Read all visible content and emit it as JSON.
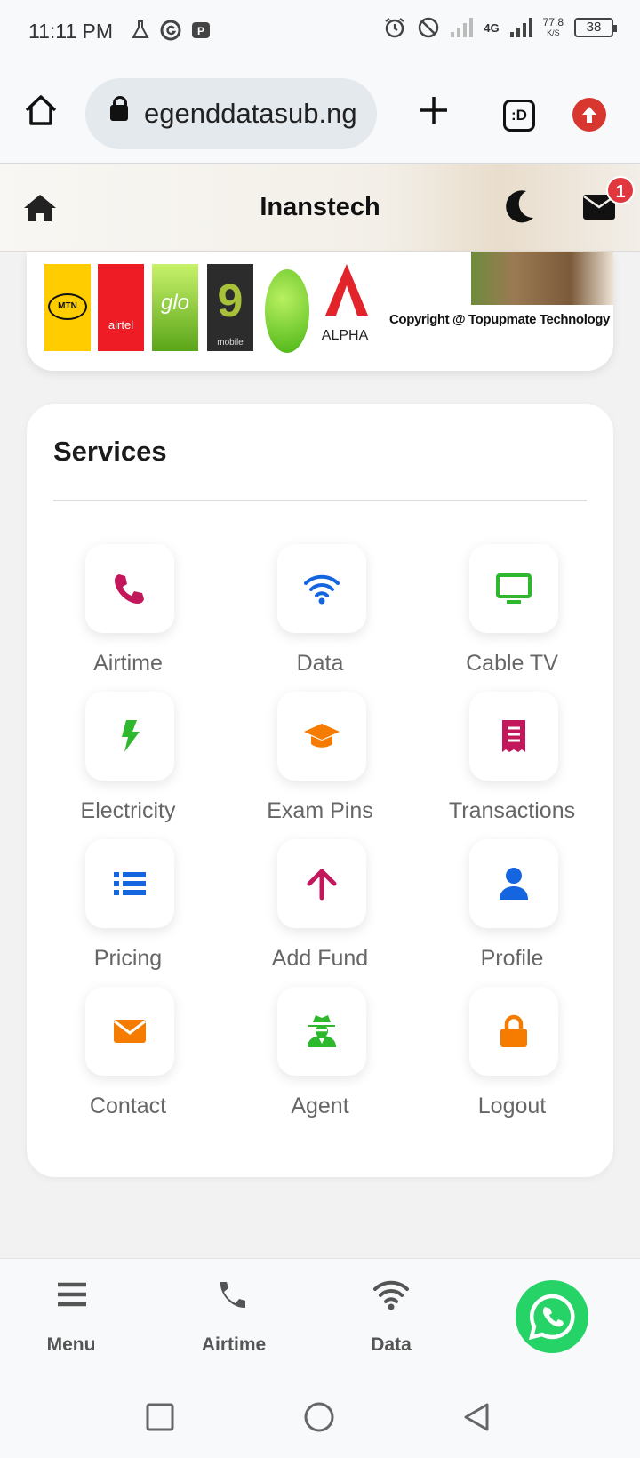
{
  "status_bar": {
    "time": "11:11 PM",
    "network": "4G",
    "speed_value": "77.8",
    "speed_unit": "K/S",
    "battery": "38"
  },
  "browser": {
    "url": "egenddatasub.ng",
    "tab_count_label": ":D"
  },
  "app_bar": {
    "title": "Inanstech",
    "mail_badge": "1"
  },
  "banner": {
    "logos": [
      "MTN",
      "airtel",
      "glo",
      "9",
      "mobile",
      "ALPHA"
    ],
    "copyright": "Copyright @ Topupmate Technology LTD"
  },
  "services": {
    "heading": "Services",
    "items": [
      {
        "label": "Airtime",
        "icon": "phone-icon",
        "color": "#c2185b"
      },
      {
        "label": "Data",
        "icon": "wifi-icon",
        "color": "#1565e0"
      },
      {
        "label": "Cable TV",
        "icon": "tv-icon",
        "color": "#2db82d"
      },
      {
        "label": "Electricity",
        "icon": "bolt-icon",
        "color": "#2db82d"
      },
      {
        "label": "Exam Pins",
        "icon": "graduation-cap-icon",
        "color": "#f57c00"
      },
      {
        "label": "Transactions",
        "icon": "receipt-icon",
        "color": "#c2185b"
      },
      {
        "label": "Pricing",
        "icon": "list-icon",
        "color": "#1565e0"
      },
      {
        "label": "Add Fund",
        "icon": "arrow-up-icon",
        "color": "#c2185b"
      },
      {
        "label": "Profile",
        "icon": "user-icon",
        "color": "#1565e0"
      },
      {
        "label": "Contact",
        "icon": "envelope-icon",
        "color": "#f57c00"
      },
      {
        "label": "Agent",
        "icon": "user-secret-icon",
        "color": "#2db82d"
      },
      {
        "label": "Logout",
        "icon": "lock-icon",
        "color": "#f57c00"
      }
    ]
  },
  "bottom_nav": {
    "menu": "Menu",
    "airtime": "Airtime",
    "data": "Data"
  }
}
